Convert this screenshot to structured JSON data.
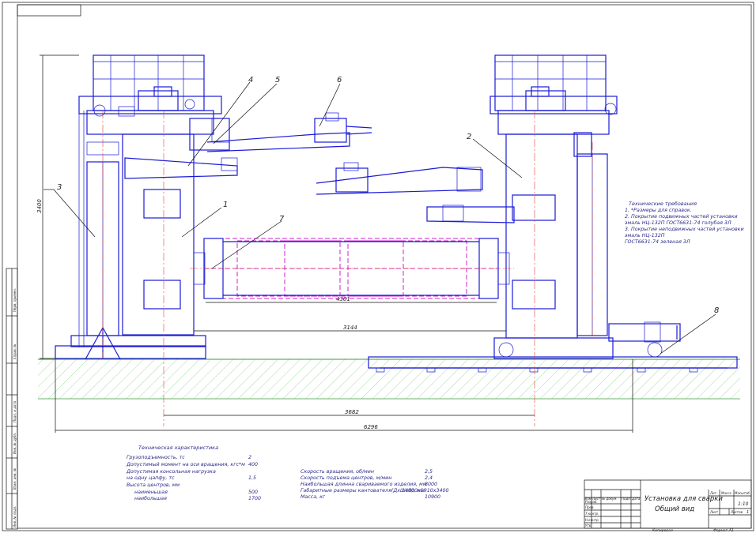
{
  "callouts": [
    "1",
    "2",
    "3",
    "4",
    "5",
    "6",
    "7",
    "8"
  ],
  "dimensions": {
    "height": "3400",
    "span1": "4301",
    "span2": "3144",
    "span3": "3682",
    "overall": "6296"
  },
  "requirements": {
    "title": "Технические требования",
    "lines": [
      "1. *Размеры для справок.",
      "2. Покрытие подвижных частей установки",
      "эмаль НЦ-132П ГОСТ6631-74 голубая 3Л",
      "3. Покрытие неподвижных частей установки",
      "эмаль НЦ-132П",
      "ГОСТ6631-74 зеленая 3Л"
    ]
  },
  "specs": {
    "title": "Техническая характеристика",
    "left": [
      {
        "label": "Грузоподъемность, тс",
        "value": "2"
      },
      {
        "label": "Допустимый момент на оси вращения, кгс*м",
        "value": "400"
      },
      {
        "label": "Допустимая консольная нагрузка",
        "value": ""
      },
      {
        "label": "на одну цапфу, тс",
        "value": "1,5"
      },
      {
        "label": "Высота центров, мм",
        "value": ""
      },
      {
        "label": "наименьшая",
        "value": "500"
      },
      {
        "label": "наибольшая",
        "value": "1700"
      }
    ],
    "right": [
      {
        "label": "Скорость вращения, об/мин",
        "value": "2,5"
      },
      {
        "label": "Скорость подъема центров, м/мин",
        "value": "2,4"
      },
      {
        "label": "Наибольшая длинна свариваемого изделия, мм",
        "value": "8000"
      },
      {
        "label": "Габаритные размеры кантователя(ДхШхВ), мм",
        "value": "14000х1910х3400"
      },
      {
        "label": "Масса, кг",
        "value": "10900"
      }
    ]
  },
  "title_block": {
    "name_line1": "Установка для сварки",
    "name_line2": "Общий вид",
    "scale": "1:10",
    "col_labels": [
      "Изм",
      "Лист",
      "№ докум.",
      "Подп.",
      "Дата"
    ],
    "row_labels": [
      "Разраб.",
      "Пров.",
      "Т.контр.",
      "Н.контр.",
      "Утв."
    ],
    "small_labels": [
      "Лит.",
      "Масса",
      "Масштаб",
      "Лист",
      "Листов"
    ],
    "sheets": "1",
    "sheet_word": "Лист",
    "sheets_word": "Листов",
    "copied": "Копировал",
    "format": "Формат А1"
  },
  "side_stamps": [
    "Перв. примен.",
    "Справ. №",
    "Подп. и дата",
    "Инв. № дубл.",
    "Взам. инв. №",
    "Подп. и дата",
    "Инв. № подл."
  ]
}
